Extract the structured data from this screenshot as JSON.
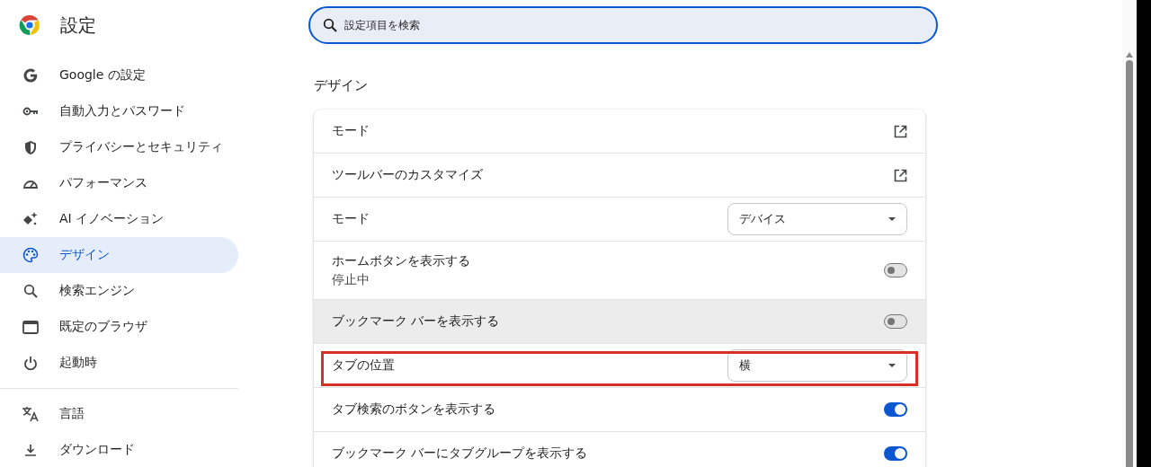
{
  "header": {
    "title": "設定"
  },
  "search": {
    "placeholder": "設定項目を検索"
  },
  "sidebar": {
    "groups": [
      {
        "items": [
          {
            "label": "Google の設定",
            "selected": false
          },
          {
            "label": "自動入力とパスワード",
            "selected": false
          },
          {
            "label": "プライバシーとセキュリティ",
            "selected": false
          },
          {
            "label": "パフォーマンス",
            "selected": false
          },
          {
            "label": "AI イノベーション",
            "selected": false
          },
          {
            "label": "デザイン",
            "selected": true
          },
          {
            "label": "検索エンジン",
            "selected": false
          },
          {
            "label": "既定のブラウザ",
            "selected": false
          },
          {
            "label": "起動時",
            "selected": false
          }
        ]
      },
      {
        "items": [
          {
            "label": "言語",
            "selected": false
          },
          {
            "label": "ダウンロード",
            "selected": false
          }
        ]
      }
    ]
  },
  "section": {
    "title": "デザイン",
    "rows": [
      {
        "kind": "link",
        "label": "モード",
        "hovered": false,
        "annotated": false
      },
      {
        "kind": "link",
        "label": "ツールバーのカスタマイズ",
        "hovered": false,
        "annotated": false
      },
      {
        "kind": "dropdown",
        "label": "モード",
        "value": "デバイス",
        "hovered": false,
        "annotated": false
      },
      {
        "kind": "toggle",
        "label": "ホームボタンを表示する",
        "sublabel": "停止中",
        "on": false,
        "hovered": false,
        "annotated": false
      },
      {
        "kind": "toggle",
        "label": "ブックマーク バーを表示する",
        "on": false,
        "hovered": true,
        "annotated": false
      },
      {
        "kind": "dropdown",
        "label": "タブの位置",
        "value": "横",
        "hovered": false,
        "annotated": true
      },
      {
        "kind": "toggle",
        "label": "タブ検索のボタンを表示する",
        "on": true,
        "hovered": false,
        "annotated": false
      },
      {
        "kind": "toggle",
        "label": "ブックマーク バーにタブグループを表示する",
        "on": true,
        "hovered": false,
        "annotated": false
      }
    ]
  }
}
